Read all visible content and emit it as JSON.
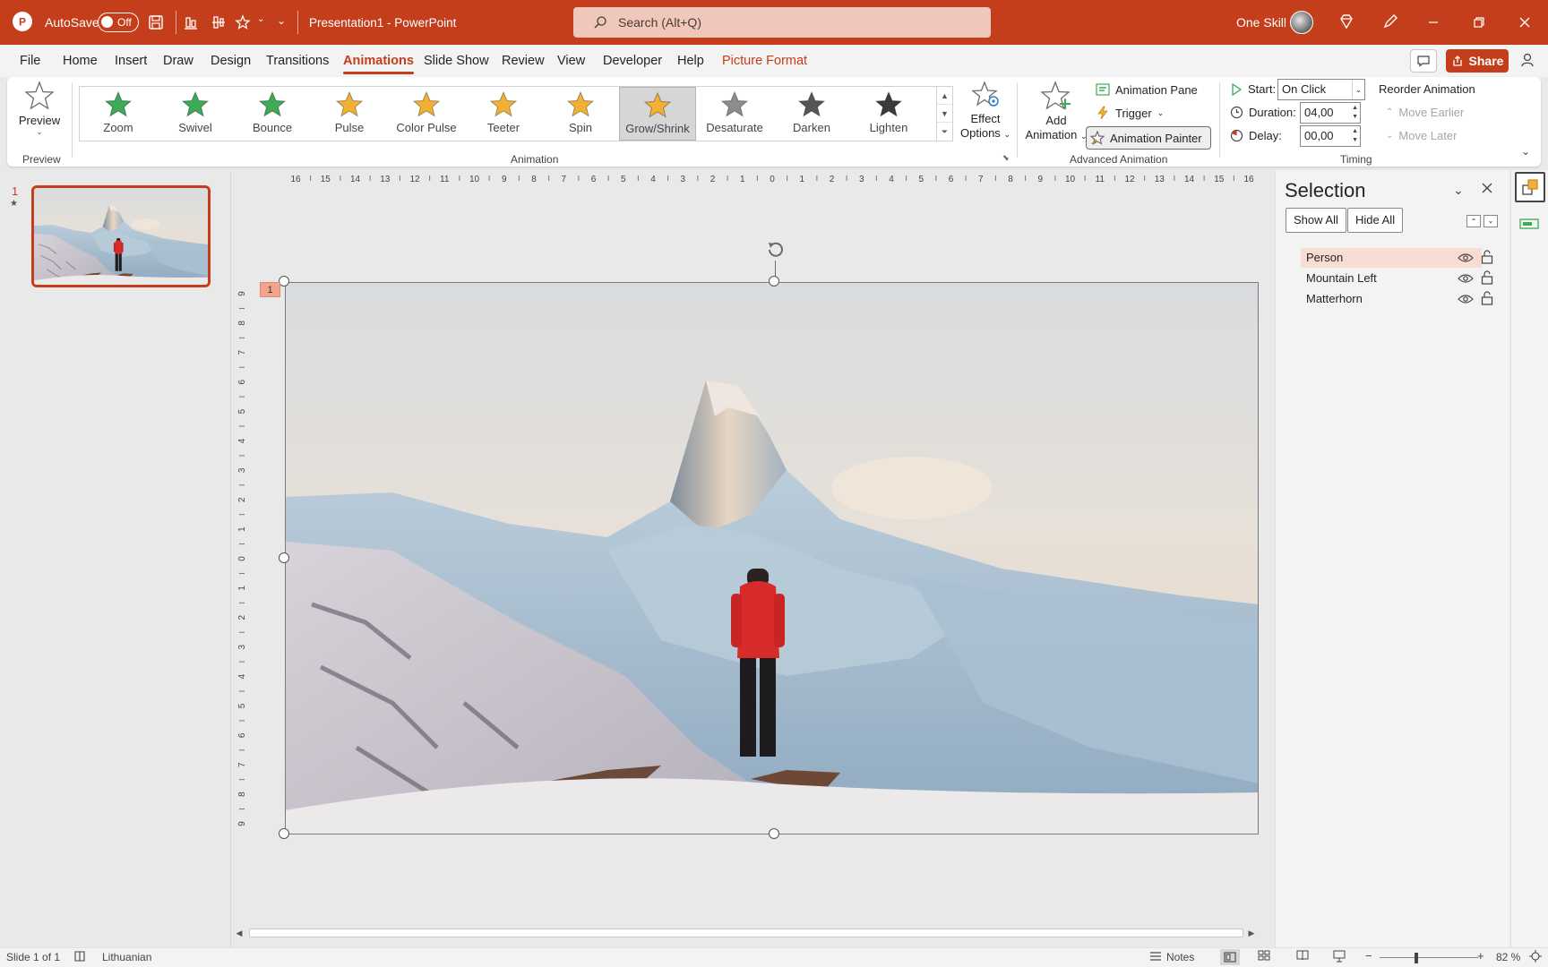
{
  "titlebar": {
    "autosave_label": "AutoSave",
    "autosave_state": "Off",
    "doc_title": "Presentation1  -  PowerPoint",
    "search_placeholder": "Search (Alt+Q)",
    "user_name": "One Skill"
  },
  "menu": {
    "tabs": [
      "File",
      "Home",
      "Insert",
      "Draw",
      "Design",
      "Transitions",
      "Animations",
      "Slide Show",
      "Review",
      "View",
      "Developer",
      "Help",
      "Picture Format"
    ],
    "active_tab": "Animations",
    "share_label": "Share"
  },
  "ribbon": {
    "preview": {
      "label": "Preview",
      "group": "Preview"
    },
    "animation_gallery": [
      {
        "label": "Zoom",
        "color": "#3daa55"
      },
      {
        "label": "Swivel",
        "color": "#3daa55"
      },
      {
        "label": "Bounce",
        "color": "#3daa55"
      },
      {
        "label": "Pulse",
        "color": "#f2b134"
      },
      {
        "label": "Color Pulse",
        "color": "#f2b134"
      },
      {
        "label": "Teeter",
        "color": "#f2b134"
      },
      {
        "label": "Spin",
        "color": "#f2b134"
      },
      {
        "label": "Grow/Shrink",
        "color": "#f2b134"
      },
      {
        "label": "Desaturate",
        "color": "#8d8d8d"
      },
      {
        "label": "Darken",
        "color": "#555555"
      },
      {
        "label": "Lighten",
        "color": "#3a3a3a"
      }
    ],
    "selected_animation": "Grow/Shrink",
    "effect_options_line1": "Effect",
    "effect_options_line2": "Options",
    "animation_group": "Animation",
    "add_animation_line1": "Add",
    "add_animation_line2": "Animation",
    "animation_pane": "Animation Pane",
    "trigger": "Trigger",
    "animation_painter": "Animation Painter",
    "advanced_group": "Advanced Animation",
    "start_label": "Start:",
    "start_value": "On Click",
    "duration_label": "Duration:",
    "duration_value": "04,00",
    "delay_label": "Delay:",
    "delay_value": "00,00",
    "timing_group": "Timing",
    "reorder_label": "Reorder Animation",
    "move_earlier": "Move Earlier",
    "move_later": "Move Later"
  },
  "slides": {
    "number": "1",
    "anim_marker": "★"
  },
  "canvas": {
    "animation_tag": "1",
    "ruler_h": [
      "16",
      "15",
      "14",
      "13",
      "12",
      "11",
      "10",
      "9",
      "8",
      "7",
      "6",
      "5",
      "4",
      "3",
      "2",
      "1",
      "0",
      "1",
      "2",
      "3",
      "4",
      "5",
      "6",
      "7",
      "8",
      "9",
      "10",
      "11",
      "12",
      "13",
      "14",
      "15",
      "16"
    ],
    "ruler_v": [
      "9",
      "8",
      "7",
      "6",
      "5",
      "4",
      "3",
      "2",
      "1",
      "0",
      "1",
      "2",
      "3",
      "4",
      "5",
      "6",
      "7",
      "8",
      "9"
    ]
  },
  "selection_pane": {
    "title": "Selection",
    "show_all": "Show All",
    "hide_all": "Hide All",
    "items": [
      {
        "label": "Person",
        "selected": true
      },
      {
        "label": "Mountain Left",
        "selected": false
      },
      {
        "label": "Matterhorn",
        "selected": false
      }
    ]
  },
  "statusbar": {
    "slide_info": "Slide 1 of 1",
    "language": "Lithuanian",
    "notes": "Notes",
    "zoom": "82 %"
  }
}
